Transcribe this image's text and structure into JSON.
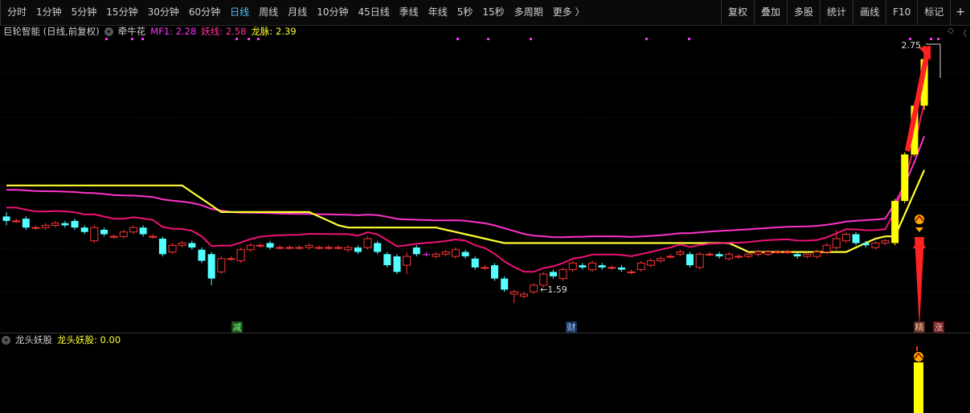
{
  "toolbar": {
    "tabs": [
      "分时",
      "1分钟",
      "5分钟",
      "15分钟",
      "30分钟",
      "60分钟",
      "日线",
      "周线",
      "月线",
      "10分钟",
      "45日线",
      "季线",
      "年线",
      "5秒",
      "15秒",
      "多周期",
      "更多 〉"
    ],
    "active_tab": "日线",
    "right_tools": [
      "复权",
      "叠加",
      "多股",
      "统计",
      "画线",
      "F10",
      "标记",
      "+"
    ]
  },
  "legend": {
    "title": "巨轮智能 (日线,前复权)",
    "indicator": "牵牛花",
    "mf1": "MF1: 2.28",
    "yao": "妖线: 2.58",
    "long": "龙脉: 2.39"
  },
  "annotations": {
    "high_label": "2.75",
    "low_label": "←1.59",
    "tag_jian": "减",
    "tag_cai": "财",
    "tag_jing": "精",
    "tag_zhang": "涨"
  },
  "lower": {
    "name": "龙头妖股",
    "value_text": "龙头妖股: 0.00"
  },
  "colors": {
    "up": "#ff3333",
    "down": "#54ffff",
    "mf1": "#ff33cc",
    "yao": "#ee1177",
    "long": "#ffff33",
    "accent": "#4fc3f7"
  },
  "chart_data": {
    "type": "candlestick",
    "series": [
      {
        "name": "MF1",
        "color": "#ff33cc"
      },
      {
        "name": "妖线",
        "color": "#ee1177"
      },
      {
        "name": "龙脉",
        "color": "#ffff33"
      }
    ],
    "low_marker": 1.59,
    "high_marker": 2.75,
    "candles": [
      [
        1.98,
        1.96,
        2.0,
        1.94
      ],
      [
        1.96,
        1.96,
        1.97,
        1.95
      ],
      [
        1.97,
        1.93,
        1.98,
        1.92
      ],
      [
        1.93,
        1.93,
        1.94,
        1.92
      ],
      [
        1.93,
        1.94,
        1.95,
        1.92
      ],
      [
        1.94,
        1.95,
        1.96,
        1.93
      ],
      [
        1.95,
        1.94,
        1.96,
        1.93
      ],
      [
        1.96,
        1.93,
        1.97,
        1.92
      ],
      [
        1.93,
        1.91,
        1.94,
        1.9
      ],
      [
        1.87,
        1.93,
        1.94,
        1.86
      ],
      [
        1.92,
        1.9,
        1.93,
        1.89
      ],
      [
        1.89,
        1.89,
        1.9,
        1.88
      ],
      [
        1.89,
        1.91,
        1.92,
        1.88
      ],
      [
        1.91,
        1.93,
        1.94,
        1.9
      ],
      [
        1.93,
        1.9,
        1.94,
        1.89
      ],
      [
        1.89,
        1.89,
        1.9,
        1.88
      ],
      [
        1.88,
        1.81,
        1.89,
        1.8
      ],
      [
        1.82,
        1.85,
        1.86,
        1.81
      ],
      [
        1.85,
        1.86,
        1.87,
        1.84
      ],
      [
        1.86,
        1.84,
        1.87,
        1.83
      ],
      [
        1.83,
        1.78,
        1.84,
        1.77
      ],
      [
        1.81,
        1.7,
        1.82,
        1.67
      ],
      [
        1.73,
        1.79,
        1.8,
        1.72
      ],
      [
        1.79,
        1.79,
        1.8,
        1.78
      ],
      [
        1.78,
        1.83,
        1.84,
        1.77
      ],
      [
        1.83,
        1.85,
        1.86,
        1.82
      ],
      [
        1.85,
        1.85,
        1.86,
        1.84
      ],
      [
        1.86,
        1.84,
        1.87,
        1.83
      ],
      [
        1.84,
        1.84,
        1.85,
        1.83
      ],
      [
        1.84,
        1.84,
        1.85,
        1.83
      ],
      [
        1.84,
        1.84,
        1.85,
        1.83
      ],
      [
        1.84,
        1.85,
        1.86,
        1.83
      ],
      [
        1.84,
        1.84,
        1.85,
        1.83
      ],
      [
        1.84,
        1.84,
        1.85,
        1.83
      ],
      [
        1.84,
        1.84,
        1.85,
        1.83
      ],
      [
        1.83,
        1.84,
        1.85,
        1.82
      ],
      [
        1.84,
        1.82,
        1.85,
        1.81
      ],
      [
        1.84,
        1.88,
        1.89,
        1.83
      ],
      [
        1.86,
        1.82,
        1.87,
        1.81
      ],
      [
        1.81,
        1.76,
        1.82,
        1.75
      ],
      [
        1.8,
        1.73,
        1.81,
        1.72
      ],
      [
        1.76,
        1.8,
        1.82,
        1.72
      ],
      [
        1.84,
        1.81,
        1.85,
        1.8
      ],
      [
        1.81,
        1.81,
        1.82,
        1.8
      ],
      [
        1.8,
        1.81,
        1.82,
        1.79
      ],
      [
        1.81,
        1.82,
        1.83,
        1.8
      ],
      [
        1.8,
        1.83,
        1.84,
        1.79
      ],
      [
        1.82,
        1.8,
        1.83,
        1.79
      ],
      [
        1.79,
        1.75,
        1.8,
        1.74
      ],
      [
        1.75,
        1.75,
        1.76,
        1.74
      ],
      [
        1.76,
        1.7,
        1.77,
        1.69
      ],
      [
        1.7,
        1.65,
        1.71,
        1.64
      ],
      [
        1.63,
        1.64,
        1.65,
        1.59
      ],
      [
        1.62,
        1.63,
        1.64,
        1.61
      ],
      [
        1.64,
        1.67,
        1.68,
        1.63
      ],
      [
        1.67,
        1.72,
        1.73,
        1.66
      ],
      [
        1.73,
        1.71,
        1.74,
        1.7
      ],
      [
        1.7,
        1.74,
        1.75,
        1.69
      ],
      [
        1.74,
        1.77,
        1.78,
        1.73
      ],
      [
        1.76,
        1.75,
        1.77,
        1.74
      ],
      [
        1.74,
        1.77,
        1.78,
        1.73
      ],
      [
        1.76,
        1.75,
        1.77,
        1.74
      ],
      [
        1.75,
        1.75,
        1.76,
        1.74
      ],
      [
        1.75,
        1.74,
        1.76,
        1.73
      ],
      [
        1.73,
        1.73,
        1.74,
        1.72
      ],
      [
        1.74,
        1.77,
        1.78,
        1.73
      ],
      [
        1.76,
        1.78,
        1.79,
        1.75
      ],
      [
        1.78,
        1.79,
        1.8,
        1.77
      ],
      [
        1.8,
        1.8,
        1.81,
        1.79
      ],
      [
        1.81,
        1.82,
        1.83,
        1.8
      ],
      [
        1.81,
        1.76,
        1.82,
        1.75
      ],
      [
        1.75,
        1.81,
        1.82,
        1.74
      ],
      [
        1.81,
        1.81,
        1.82,
        1.8
      ],
      [
        1.81,
        1.8,
        1.82,
        1.79
      ],
      [
        1.79,
        1.81,
        1.82,
        1.78
      ],
      [
        1.8,
        1.8,
        1.81,
        1.79
      ],
      [
        1.8,
        1.81,
        1.82,
        1.79
      ],
      [
        1.81,
        1.82,
        1.83,
        1.8
      ],
      [
        1.81,
        1.82,
        1.83,
        1.8
      ],
      [
        1.82,
        1.82,
        1.83,
        1.81
      ],
      [
        1.82,
        1.82,
        1.83,
        1.81
      ],
      [
        1.81,
        1.8,
        1.82,
        1.79
      ],
      [
        1.8,
        1.81,
        1.82,
        1.79
      ],
      [
        1.8,
        1.82,
        1.83,
        1.79
      ],
      [
        1.82,
        1.85,
        1.86,
        1.81
      ],
      [
        1.84,
        1.88,
        1.92,
        1.83
      ],
      [
        1.87,
        1.9,
        1.91,
        1.86
      ],
      [
        1.9,
        1.86,
        1.91,
        1.85
      ],
      [
        1.86,
        1.85,
        1.87,
        1.84
      ],
      [
        1.84,
        1.86,
        1.87,
        1.83
      ],
      [
        1.86,
        1.87,
        1.88,
        1.85
      ],
      [
        1.86,
        2.05,
        2.06,
        1.85
      ],
      [
        2.05,
        2.26,
        2.27,
        2.04
      ],
      [
        2.26,
        2.48,
        2.49,
        2.25
      ],
      [
        2.48,
        2.69,
        2.75,
        2.46
      ]
    ]
  }
}
